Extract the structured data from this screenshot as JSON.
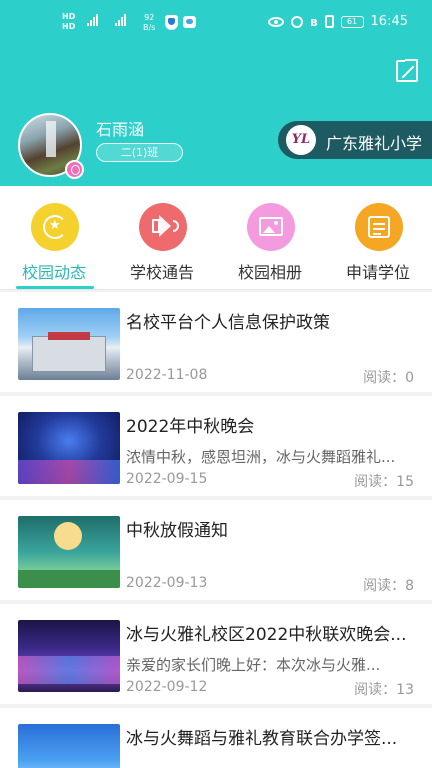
{
  "status_bar": {
    "net_speed_value": "92",
    "net_speed_unit": "B/s",
    "battery": "61",
    "time": "16:45"
  },
  "profile": {
    "name": "石雨涵",
    "class": "二(1)班"
  },
  "school": {
    "logo_text": "YL",
    "name": "广东雅礼小学"
  },
  "nav": {
    "items": [
      {
        "label": "校园动态",
        "icon": "star-refresh-icon",
        "color": "#f5d12e",
        "active": true
      },
      {
        "label": "学校通告",
        "icon": "megaphone-icon",
        "color": "#ee6a6c",
        "active": false
      },
      {
        "label": "校园相册",
        "icon": "photo-icon",
        "color": "#f49be0",
        "active": false
      },
      {
        "label": "申请学位",
        "icon": "form-icon",
        "color": "#f5a623",
        "active": false
      }
    ]
  },
  "news": [
    {
      "title": "名校平台个人信息保护政策",
      "summary": "",
      "date": "2022-11-08",
      "read_label": "阅读：",
      "reads": "0"
    },
    {
      "title": "2022年中秋晚会",
      "summary": "浓情中秋，感恩坦洲，冰与火舞蹈雅礼...",
      "date": "2022-09-15",
      "read_label": "阅读：",
      "reads": "15"
    },
    {
      "title": "中秋放假通知",
      "summary": "",
      "date": "2022-09-13",
      "read_label": "阅读：",
      "reads": "8"
    },
    {
      "title": "冰与火雅礼校区2022中秋联欢晚会...",
      "summary": "亲爱的家长们晚上好：本次冰与火雅...",
      "date": "2022-09-12",
      "read_label": "阅读：",
      "reads": "13"
    },
    {
      "title": "冰与火舞蹈与雅礼教育联合办学签...",
      "summary": "",
      "date": "",
      "read_label": "",
      "reads": ""
    }
  ],
  "colors": {
    "header": "#2ccfc9",
    "accent_text": "#2bb8b3",
    "school_badge": "#1e5a61"
  }
}
